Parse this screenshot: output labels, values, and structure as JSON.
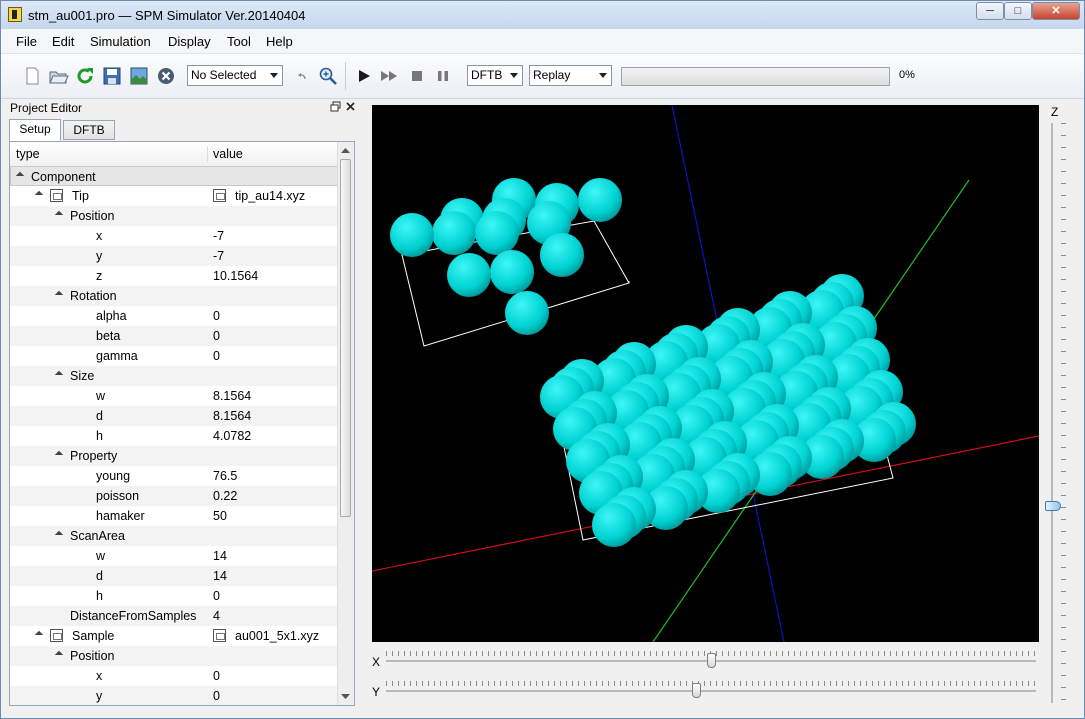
{
  "window": {
    "title": "stm_au001.pro — SPM Simulator Ver.20140404",
    "minimize": "─",
    "maximize": "□",
    "close": "✕"
  },
  "menu": [
    "File",
    "Edit",
    "Simulation",
    "Display",
    "Tool",
    "Help"
  ],
  "toolbar": {
    "icons": [
      "new-file-icon",
      "open-folder-icon",
      "reload-icon",
      "save-icon",
      "image-icon",
      "close-circle-icon",
      "undo-icon",
      "zoom-icon",
      "play-icon",
      "fast-forward-icon",
      "stop-icon",
      "pause-icon"
    ],
    "selection": "No Selected",
    "mode": "DFTB",
    "replay": "Replay",
    "progress_percent": 0,
    "progress_label": "0%"
  },
  "project_editor": {
    "title": "Project Editor",
    "tabs": [
      "Setup",
      "DFTB"
    ],
    "columns": [
      "type",
      "value"
    ],
    "rows": [
      {
        "label": "Component",
        "value": "",
        "indent": 0,
        "expand": true,
        "icon": false
      },
      {
        "label": "Tip",
        "value": "tip_au14.xyz",
        "indent": 1,
        "expand": true,
        "icon": true
      },
      {
        "label": "Position",
        "value": "",
        "indent": 2,
        "expand": true,
        "icon": false
      },
      {
        "label": "x",
        "value": "-7",
        "indent": 3,
        "expand": false,
        "icon": false
      },
      {
        "label": "y",
        "value": "-7",
        "indent": 3,
        "expand": false,
        "icon": false
      },
      {
        "label": "z",
        "value": "10.1564",
        "indent": 3,
        "expand": false,
        "icon": false
      },
      {
        "label": "Rotation",
        "value": "",
        "indent": 2,
        "expand": true,
        "icon": false
      },
      {
        "label": "alpha",
        "value": "0",
        "indent": 3,
        "expand": false,
        "icon": false
      },
      {
        "label": "beta",
        "value": "0",
        "indent": 3,
        "expand": false,
        "icon": false
      },
      {
        "label": "gamma",
        "value": "0",
        "indent": 3,
        "expand": false,
        "icon": false
      },
      {
        "label": "Size",
        "value": "",
        "indent": 2,
        "expand": true,
        "icon": false
      },
      {
        "label": "w",
        "value": "8.1564",
        "indent": 3,
        "expand": false,
        "icon": false
      },
      {
        "label": "d",
        "value": "8.1564",
        "indent": 3,
        "expand": false,
        "icon": false
      },
      {
        "label": "h",
        "value": "4.0782",
        "indent": 3,
        "expand": false,
        "icon": false
      },
      {
        "label": "Property",
        "value": "",
        "indent": 2,
        "expand": true,
        "icon": false
      },
      {
        "label": "young",
        "value": "76.5",
        "indent": 3,
        "expand": false,
        "icon": false
      },
      {
        "label": "poisson",
        "value": "0.22",
        "indent": 3,
        "expand": false,
        "icon": false
      },
      {
        "label": "hamaker",
        "value": "50",
        "indent": 3,
        "expand": false,
        "icon": false
      },
      {
        "label": "ScanArea",
        "value": "",
        "indent": 2,
        "expand": true,
        "icon": false
      },
      {
        "label": "w",
        "value": "14",
        "indent": 3,
        "expand": false,
        "icon": false
      },
      {
        "label": "d",
        "value": "14",
        "indent": 3,
        "expand": false,
        "icon": false
      },
      {
        "label": "h",
        "value": "0",
        "indent": 3,
        "expand": false,
        "icon": false
      },
      {
        "label": "DistanceFromSamples",
        "value": "4",
        "indent": 2,
        "expand": false,
        "icon": false
      },
      {
        "label": "Sample",
        "value": "au001_5x1.xyz",
        "indent": 1,
        "expand": true,
        "icon": true
      },
      {
        "label": "Position",
        "value": "",
        "indent": 2,
        "expand": true,
        "icon": false
      },
      {
        "label": "x",
        "value": "0",
        "indent": 3,
        "expand": false,
        "icon": false
      },
      {
        "label": "y",
        "value": "0",
        "indent": 3,
        "expand": false,
        "icon": false
      }
    ]
  },
  "viewer": {
    "atom_color": "#00cfcf",
    "axis_colors": {
      "x": "#d01010",
      "y": "#20c020",
      "z": "#1010c0"
    },
    "sliders": {
      "x_label": "X",
      "y_label": "Y",
      "z_label": "Z",
      "x_value": 0.5,
      "y_value": 0.5,
      "z_value": 0.66
    }
  }
}
